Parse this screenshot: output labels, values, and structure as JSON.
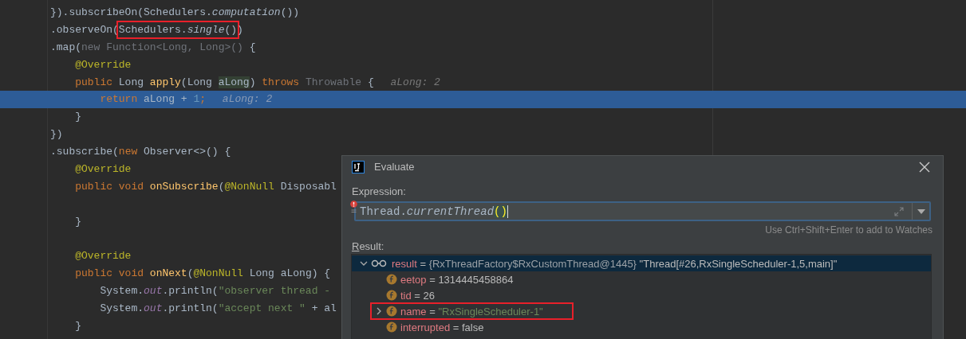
{
  "editor": {
    "lines": [
      {
        "current": false,
        "tokens": [
          {
            "kind": "plain",
            "text": "}).subscribeOn(Schedulers."
          },
          {
            "kind": "italic",
            "text": "computation"
          },
          {
            "kind": "plain",
            "text": "())"
          }
        ]
      },
      {
        "current": false,
        "tokens": [
          {
            "kind": "plain",
            "text": ".observeOn("
          },
          {
            "kind": "frame",
            "tokens": [
              {
                "kind": "plain",
                "text": "Schedulers."
              },
              {
                "kind": "italic",
                "text": "single"
              },
              {
                "kind": "plain",
                "text": "()"
              }
            ]
          },
          {
            "kind": "plain",
            "text": ")"
          }
        ]
      },
      {
        "current": false,
        "tokens": [
          {
            "kind": "plain",
            "text": ".map("
          },
          {
            "kind": "faded",
            "text": "new Function<Long, Long>()"
          },
          {
            "kind": "plain",
            "text": " {"
          }
        ]
      },
      {
        "current": false,
        "tokens": [
          {
            "kind": "annotation",
            "text": "    @Override"
          }
        ]
      },
      {
        "current": false,
        "tokens": [
          {
            "kind": "keyword",
            "text": "    public"
          },
          {
            "kind": "plain",
            "text": " Long "
          },
          {
            "kind": "method",
            "text": "apply"
          },
          {
            "kind": "plain",
            "text": "(Long "
          },
          {
            "kind": "param",
            "text": "aLong"
          },
          {
            "kind": "plain",
            "text": ") "
          },
          {
            "kind": "keyword",
            "text": "throws"
          },
          {
            "kind": "faded",
            "text": " Throwable"
          },
          {
            "kind": "plain",
            "text": " {"
          },
          {
            "kind": "hint",
            "text": "aLong: 2"
          }
        ]
      },
      {
        "current": true,
        "tokens": [
          {
            "kind": "keyword",
            "text": "        return"
          },
          {
            "kind": "plain",
            "text": " aLong + "
          },
          {
            "kind": "number",
            "text": "1"
          },
          {
            "kind": "keyword",
            "text": ";"
          },
          {
            "kind": "hint",
            "text": "aLong: 2"
          }
        ]
      },
      {
        "current": false,
        "tokens": [
          {
            "kind": "plain",
            "text": "    }"
          }
        ]
      },
      {
        "current": false,
        "tokens": [
          {
            "kind": "plain",
            "text": "})"
          }
        ]
      },
      {
        "current": false,
        "tokens": [
          {
            "kind": "plain",
            "text": ".subscribe("
          },
          {
            "kind": "keyword",
            "text": "new"
          },
          {
            "kind": "plain",
            "text": " Observer<>() {"
          }
        ]
      },
      {
        "current": false,
        "tokens": [
          {
            "kind": "annotation",
            "text": "    @Override"
          }
        ]
      },
      {
        "current": false,
        "tokens": [
          {
            "kind": "keyword",
            "text": "    public void"
          },
          {
            "kind": "method",
            "text": " onSubscribe"
          },
          {
            "kind": "plain",
            "text": "("
          },
          {
            "kind": "annotation",
            "text": "@NonNull"
          },
          {
            "kind": "plain",
            "text": " Disposabl"
          }
        ]
      },
      {
        "current": false
      },
      {
        "current": false,
        "tokens": [
          {
            "kind": "plain",
            "text": "    }"
          }
        ]
      },
      {
        "current": false
      },
      {
        "current": false,
        "tokens": [
          {
            "kind": "annotation",
            "text": "    @Override"
          }
        ]
      },
      {
        "current": false,
        "tokens": [
          {
            "kind": "keyword",
            "text": "    public void"
          },
          {
            "kind": "method",
            "text": " onNext"
          },
          {
            "kind": "plain",
            "text": "("
          },
          {
            "kind": "annotation",
            "text": "@NonNull"
          },
          {
            "kind": "plain",
            "text": " Long aLong) {"
          }
        ]
      },
      {
        "current": false,
        "tokens": [
          {
            "kind": "plain",
            "text": "        System."
          },
          {
            "kind": "static",
            "text": "out"
          },
          {
            "kind": "plain",
            "text": ".println("
          },
          {
            "kind": "string",
            "text": "\"observer thread -"
          }
        ]
      },
      {
        "current": false,
        "tokens": [
          {
            "kind": "plain",
            "text": "        System."
          },
          {
            "kind": "static",
            "text": "out"
          },
          {
            "kind": "plain",
            "text": ".println("
          },
          {
            "kind": "string",
            "text": "\"accept next \""
          },
          {
            "kind": "plain",
            "text": " + al"
          }
        ]
      },
      {
        "current": false,
        "tokens": [
          {
            "kind": "plain",
            "text": "    }"
          }
        ]
      }
    ]
  },
  "dialog": {
    "title": "Evaluate",
    "expression_label": "Expression:",
    "error": true,
    "expression": [
      {
        "kind": "plain",
        "text": "Thread."
      },
      {
        "kind": "italic",
        "text": "currentThread"
      },
      {
        "kind": "brace",
        "text": "()"
      }
    ],
    "hint": "Use Ctrl+Shift+Enter to add to Watches",
    "result_label": "Result:",
    "result": {
      "kind": "plain",
      "name": "result",
      "operator": "=",
      "type": "{RxThreadFactory$RxCustomThread@1445}",
      "value": "\"Thread[#26,RxSingleScheduler-1,5,main]\"",
      "expandable": true,
      "expanded": true,
      "selected": true,
      "framed": false,
      "children": [
        {
          "kind": "plain",
          "name": "eetop",
          "operator": "=",
          "value": "1314445458864",
          "expandable": false,
          "selected": false,
          "framed": false
        },
        {
          "kind": "plain",
          "name": "tid",
          "operator": "=",
          "value": "26",
          "expandable": false,
          "selected": false,
          "framed": false
        },
        {
          "kind": "string",
          "name": "name",
          "operator": "=",
          "value": "\"RxSingleScheduler-1\"",
          "expandable": true,
          "expanded": false,
          "selected": false,
          "framed": true
        },
        {
          "kind": "plain",
          "name": "interrupted",
          "operator": "=",
          "value": "false",
          "expandable": false,
          "selected": false,
          "framed": false
        }
      ]
    }
  }
}
